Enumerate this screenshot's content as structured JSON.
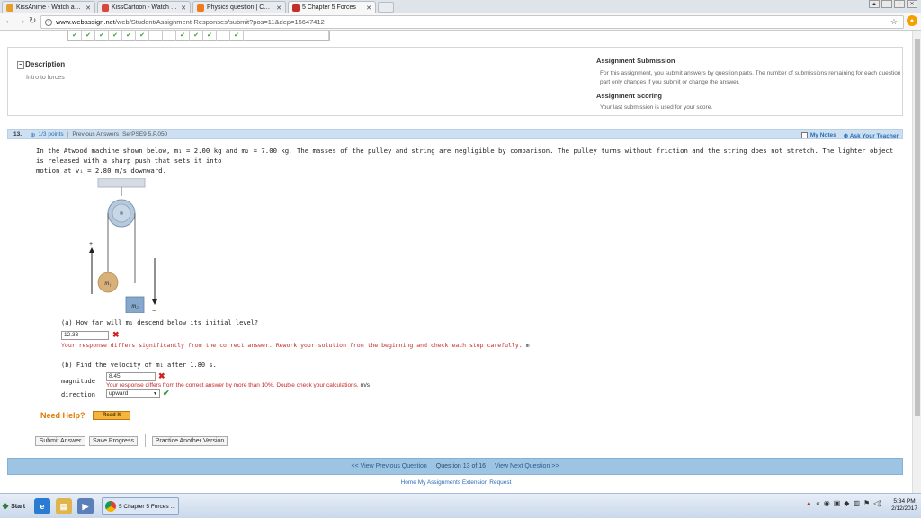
{
  "browser": {
    "tabs": [
      {
        "title": "KissAnime - Watch anim",
        "fav": "kissanime-icon",
        "fav_color": "#e4a02a"
      },
      {
        "title": "KissCartoon - Watch car",
        "fav": "kisscartoon-icon",
        "fav_color": "#d9473a"
      },
      {
        "title": "Physics question | Cheg",
        "fav": "chegg-icon",
        "fav_color": "#f07b1d"
      },
      {
        "title": "5 Chapter 5 Forces",
        "fav": "webassign-icon",
        "fav_color": "#c3302b"
      }
    ],
    "url_domain": "www.webassign.net",
    "url_path": "/web/Student/Assignment-Responses/submit?pos=11&dep=15647412"
  },
  "description": {
    "title": "Description",
    "text": "Intro to forces"
  },
  "submission": {
    "title": "Assignment Submission",
    "text": "For this assignment, you submit answers by question parts. The number of submissions remaining for each question part only changes if you submit or change the answer.",
    "scoring_title": "Assignment Scoring",
    "scoring_text": "Your last submission is used for your score."
  },
  "question": {
    "number": "13.",
    "points": "1/3 points",
    "separator": "|",
    "previous_answers": "Previous Answers",
    "code": "SerPSE9 5.P.050",
    "my_notes": "My Notes",
    "ask_teacher": "Ask Your Teacher",
    "text_line1": "In the Atwood machine shown below, m₁ = 2.00 kg and m₂ = 7.00 kg. The masses of the pulley and string are negligible by comparison. The pulley turns without friction and the string does not stretch. The lighter object is released with a sharp push that sets it into",
    "text_line2": "motion at vᵢ = 2.80 m/s downward.",
    "diagram_labels": {
      "m1": "m₁",
      "m2": "m₂",
      "plus": "+",
      "minus": "−"
    },
    "part_a": {
      "prompt": "(a) How far will m₁ descend below its initial level?",
      "answer": "12.33",
      "feedback": "Your response differs significantly from the correct answer. Rework your solution from the beginning and check each step carefully.",
      "unit": "m"
    },
    "part_b": {
      "prompt": "(b) Find the velocity of m₁ after 1.80 s.",
      "magnitude_label": "magnitude",
      "magnitude_value": "8.45",
      "feedback": "Your response differs from the correct answer by more than 10%. Double check your calculations.",
      "unit": "m/s",
      "direction_label": "direction",
      "direction_value": "upward"
    }
  },
  "help": {
    "label": "Need Help?",
    "read_it": "Read It"
  },
  "actions": {
    "submit": "Submit Answer",
    "save": "Save Progress",
    "practice": "Practice Another Version"
  },
  "nav": {
    "prev": "<< View Previous Question",
    "status": "Question 13 of 16",
    "next": "View Next Question >>",
    "footer": "Home   My Assignments   Extension Request"
  },
  "taskbar": {
    "start": "Start",
    "task": "5 Chapter 5 Forces ...",
    "time": "5:34 PM",
    "date": "2/12/2017"
  }
}
